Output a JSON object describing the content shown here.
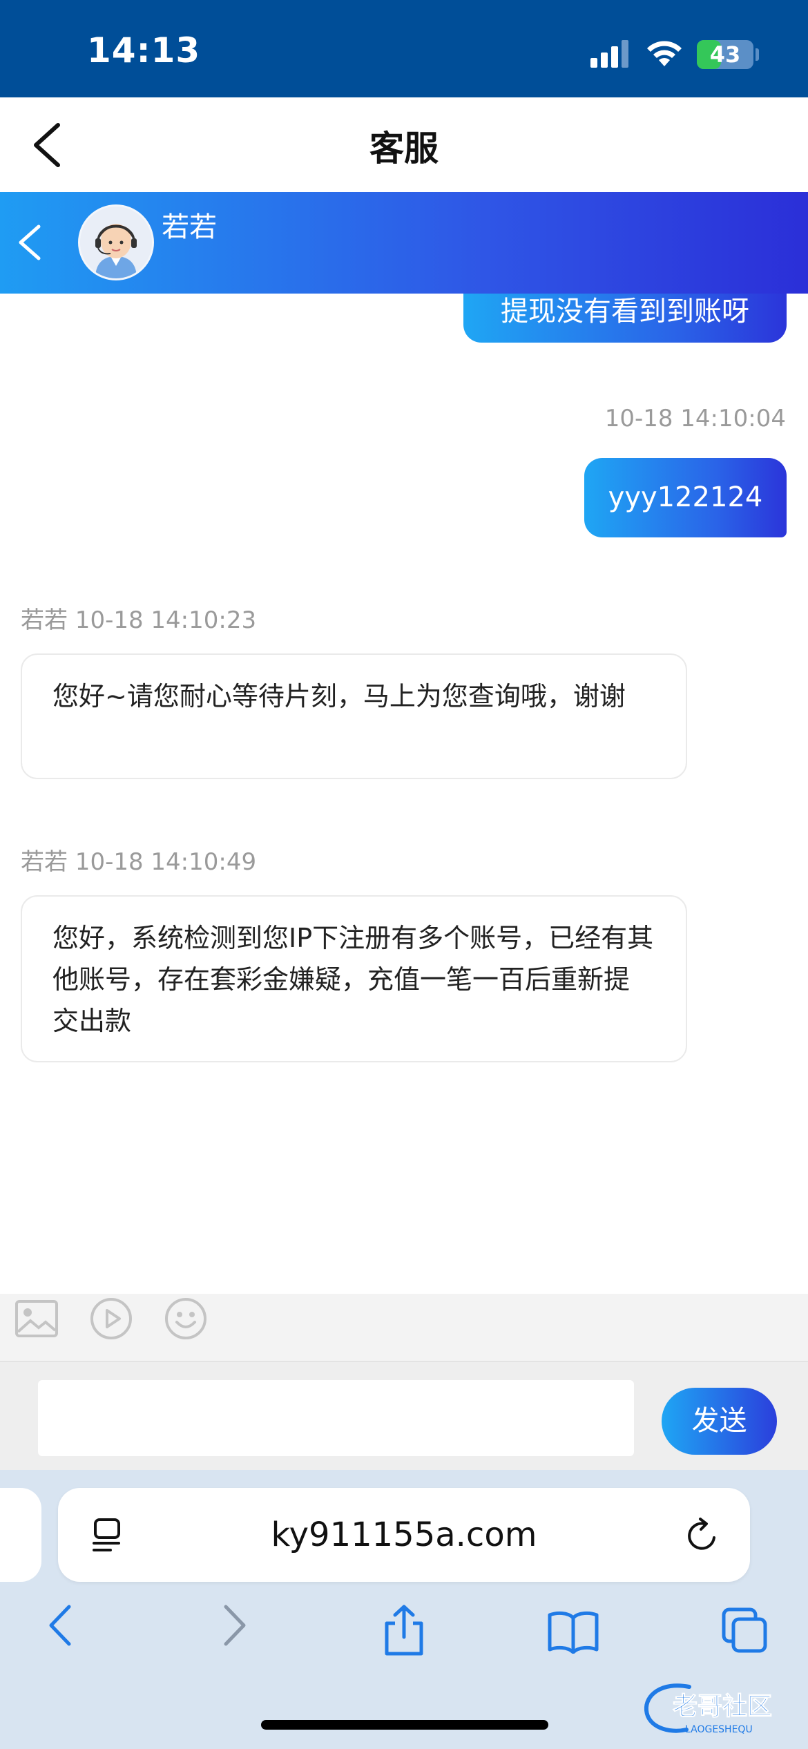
{
  "status_bar": {
    "time": "14:13",
    "battery": "43",
    "battery_level": 0.43
  },
  "header": {
    "title": "客服"
  },
  "chat_header": {
    "agent_name": "若若"
  },
  "messages": [
    {
      "side": "out",
      "text": "提现没有看到到账呀"
    },
    {
      "side": "out",
      "timestamp": "10-18 14:10:04",
      "text": "yyy122124"
    },
    {
      "side": "in",
      "sender_time": "若若 10-18 14:10:23",
      "text": "您好~请您耐心等待片刻，马上为您查询哦，谢谢"
    },
    {
      "side": "in",
      "sender_time": "若若 10-18 14:10:49",
      "text": "您好，系统检测到您IP下注册有多个账号，已经有其他账号，存在套彩金嫌疑，充值一笔一百后重新提交出款"
    }
  ],
  "toolbar": {
    "icons": [
      "image-icon",
      "video-icon",
      "emoji-icon"
    ]
  },
  "input": {
    "value": "",
    "send_label": "发送"
  },
  "browser": {
    "url": "ky911155a.com"
  },
  "watermark": {
    "main": "老哥社区",
    "sub": "LAOGESHEQU"
  }
}
